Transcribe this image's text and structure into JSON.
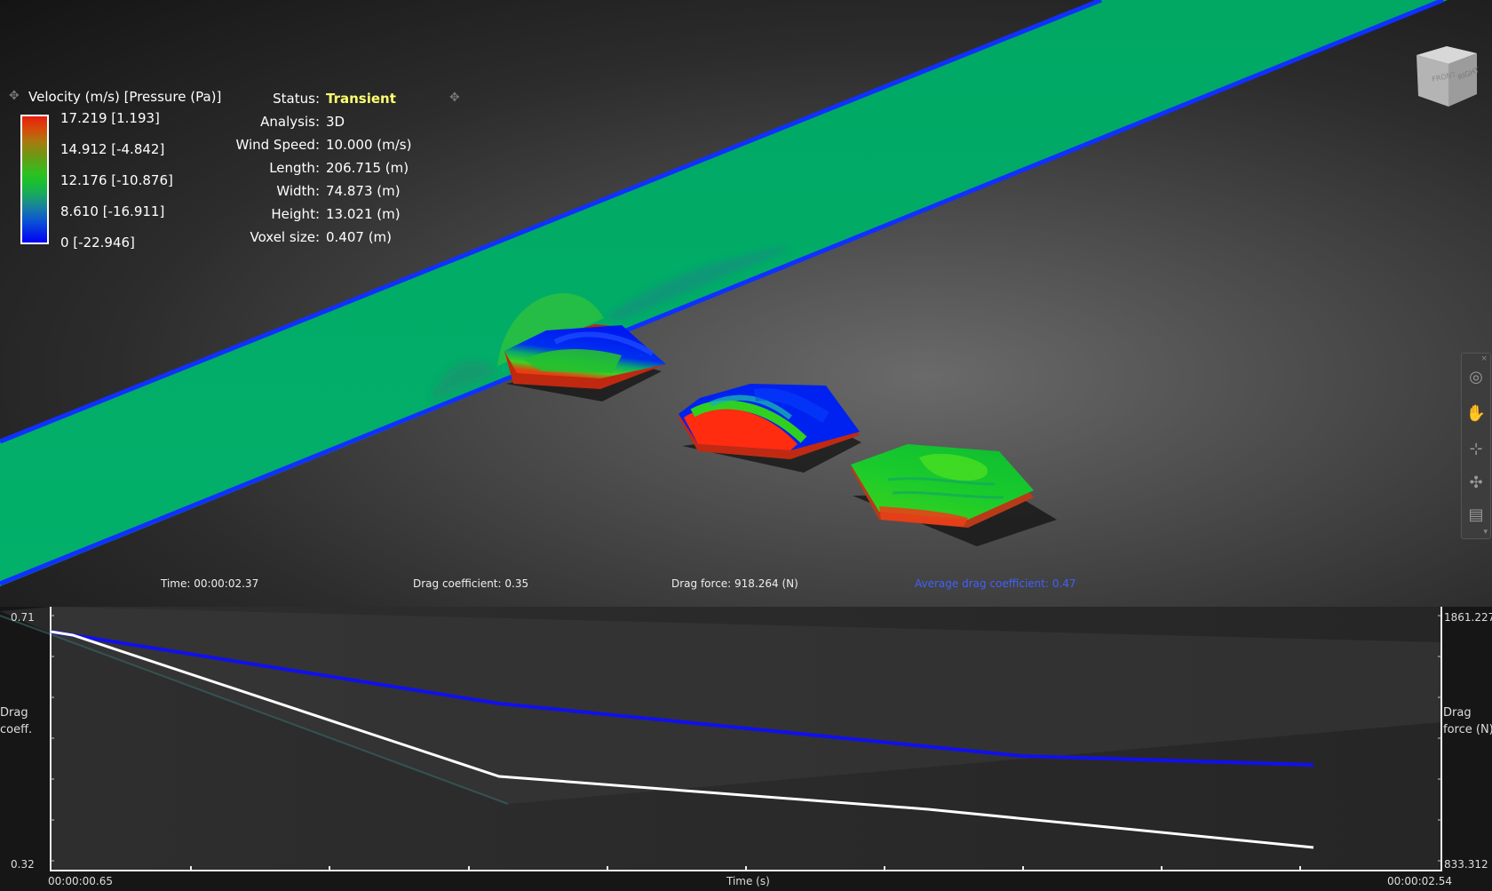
{
  "legend": {
    "title": "Velocity (m/s) [Pressure (Pa)]",
    "move_icon": "move-icon",
    "ticks": [
      "17.219 [1.193]",
      "14.912 [-4.842]",
      "12.176 [-10.876]",
      "8.610 [-16.911]",
      "0 [-22.946]"
    ],
    "colors": {
      "max": "#e51e10",
      "mid": "#2fc020",
      "min": "#0000f5"
    }
  },
  "info": {
    "status_label": "Status:",
    "status_value": "Transient",
    "analysis_label": "Analysis:",
    "analysis_value": "3D",
    "wind_label": "Wind Speed:",
    "wind_value": "10.000 (m/s)",
    "length_label": "Length:",
    "length_value": "206.715 (m)",
    "width_label": "Width:",
    "width_value": "74.873 (m)",
    "height_label": "Height:",
    "height_value": "13.021 (m)",
    "voxel_label": "Voxel size:",
    "voxel_value": "0.407 (m)",
    "move_icon": "move-icon"
  },
  "navcube": {
    "front": "FRONT",
    "right": "RIGHT"
  },
  "toolbar": [
    "orbit-icon",
    "pan-hand-icon",
    "zoom-icon",
    "look-icon",
    "window-icon"
  ],
  "readouts": {
    "time": "Time: 00:00:02.37",
    "drag_coeff": "Drag coefficient: 0.35",
    "drag_force": "Drag force: 918.264 (N)",
    "avg_drag": "Average drag coefficient: 0.47"
  },
  "graph": {
    "y_left_top": "0.71",
    "y_left_bottom": "0.32",
    "y_left_label_line1": "Drag",
    "y_left_label_line2": "coeff.",
    "y_right_top": "1861.227",
    "y_right_bottom": "833.312",
    "y_right_label_line1": "Drag",
    "y_right_label_line2": "force (N)",
    "x_start": "00:00:00.65",
    "x_end": "00:00:02.54",
    "x_label": "Time (s)",
    "colors": {
      "coeff": "#1010ee",
      "force": "#ffffff"
    }
  }
}
